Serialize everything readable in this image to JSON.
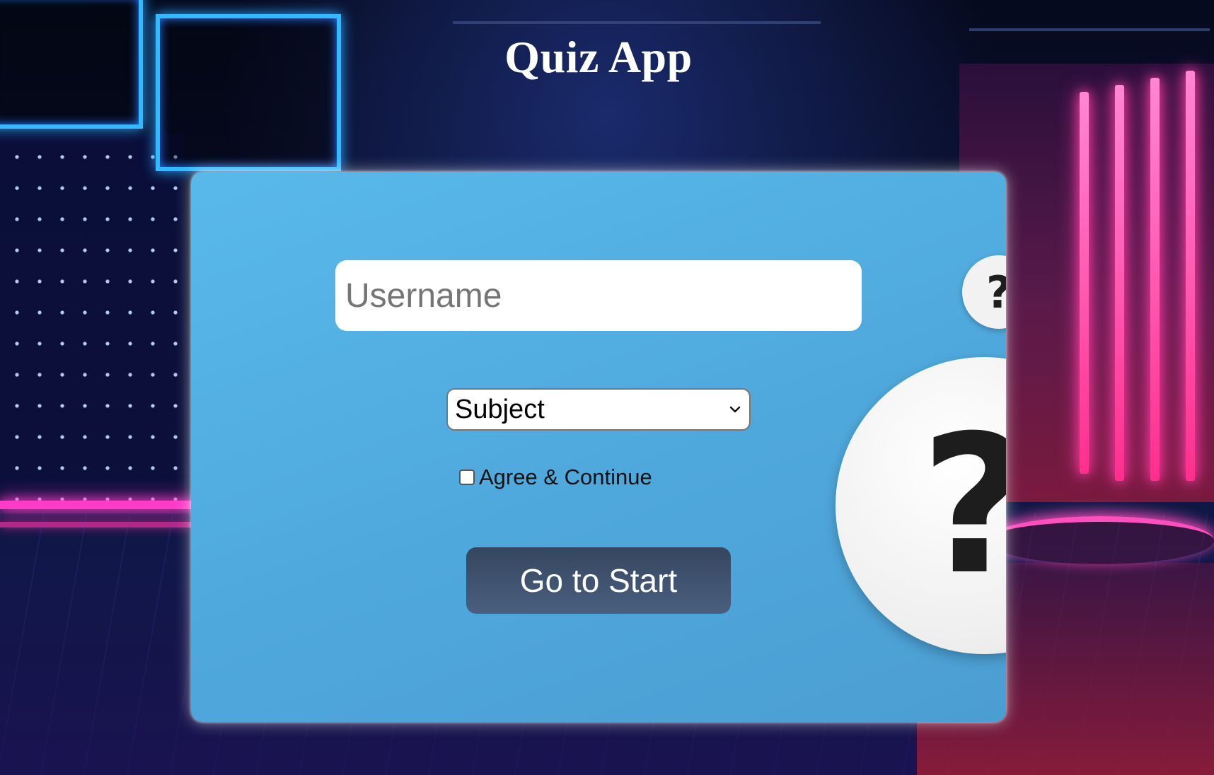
{
  "app": {
    "title": "Quiz App"
  },
  "form": {
    "username_placeholder": "Username",
    "username_value": "",
    "subject_selected": "Subject",
    "agree_label": "Agree & Continue",
    "agree_checked": false,
    "start_label": "Go to Start"
  },
  "decor": {
    "question_mark": "?",
    "icon_small": "question-mark-icon",
    "icon_large": "question-mark-icon",
    "icon_dropdown": "chevron-down-icon"
  },
  "colors": {
    "card": "#4fa8dc",
    "button": "#3d4f6b",
    "title": "#ffffff"
  }
}
